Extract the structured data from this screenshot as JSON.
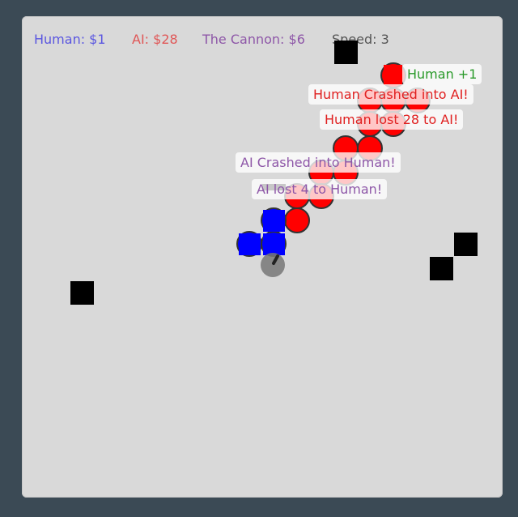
{
  "hud": {
    "human_label": "Human: $",
    "human_value": "1",
    "ai_label": "AI: $",
    "ai_value": "28",
    "cannon_label": "The Cannon: $",
    "cannon_value": "6",
    "speed_label": "Speed: ",
    "speed_value": "3"
  },
  "messages": [
    {
      "text": "Human +1",
      "color": "#2a9a2a"
    },
    {
      "text": "Human Crashed into AI!",
      "color": "#e02020"
    },
    {
      "text": "Human lost 28 to AI!",
      "color": "#e02020"
    },
    {
      "text": "AI Crashed into Human!",
      "color": "#8e57a8"
    },
    {
      "text": "AI lost 4 to Human!",
      "color": "#8e57a8"
    }
  ],
  "colors": {
    "human": "#0000ff",
    "ai": "#ff0000",
    "cannon": "#777777",
    "obstacle": "#000000",
    "board": "#d9d9d9"
  }
}
